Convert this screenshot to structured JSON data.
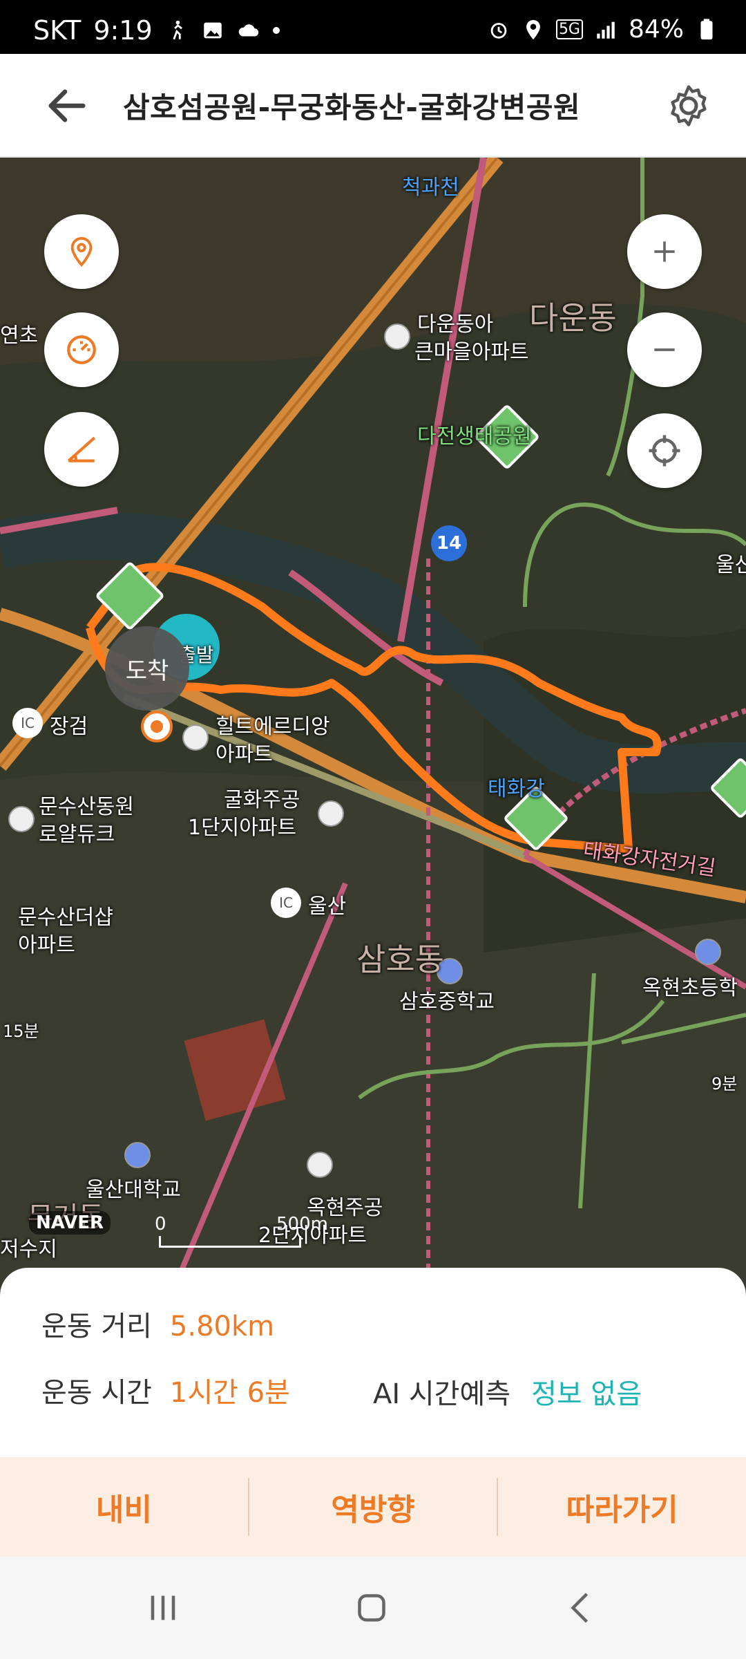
{
  "status_bar": {
    "carrier": "SKT",
    "time": "9:19",
    "battery": "84%",
    "network": "5G"
  },
  "header": {
    "title": "삼호섬공원-무궁화동산-굴화강변공원",
    "back_icon": "arrow-left-icon",
    "settings_icon": "gear-icon"
  },
  "map": {
    "labels": {
      "l1": "척과천",
      "l2": "다운동아",
      "l3": "큰마을아파트",
      "l4": "다운동",
      "l5": "다전생태공원",
      "l6": "울산",
      "l7": "연초",
      "l8": "14",
      "l9": "도착",
      "l10": "장검",
      "l11": "힐트에르디앙",
      "l12": "아파트",
      "l13": "문수산동원",
      "l14": "로얄듀크",
      "l15": "굴화주공",
      "l16": "1단지아파트",
      "l17": "태화강",
      "l18": "태화강자전거길",
      "l19": "문수산더샵",
      "l20": "아파트",
      "l21": "울산",
      "l22": "삼호동",
      "l23": "삼호중학교",
      "l24": "옥현초등학",
      "l25": "15분",
      "l26": "9분",
      "l27": "울산대학교",
      "l28": "옥현주공",
      "l29": "2단지아파트",
      "l30": "무거동",
      "l31": "저수지",
      "l32": "IC",
      "l33": "IC",
      "l34": "출발"
    },
    "naver_logo": "NAVER",
    "scale_zero": "0",
    "scale_label": "500m"
  },
  "summary": {
    "distance_label": "운동 거리",
    "distance_value": "5.80km",
    "time_label": "운동 시간",
    "time_value": "1시간 6분",
    "ai_label": "AI 시간예측",
    "ai_value": "정보 없음"
  },
  "actions": {
    "navi": "내비",
    "reverse": "역방향",
    "follow": "따라가기"
  },
  "colors": {
    "accent": "#EE7A25",
    "teal": "#1FB4B4",
    "action_bg": "#FDEEE4"
  }
}
